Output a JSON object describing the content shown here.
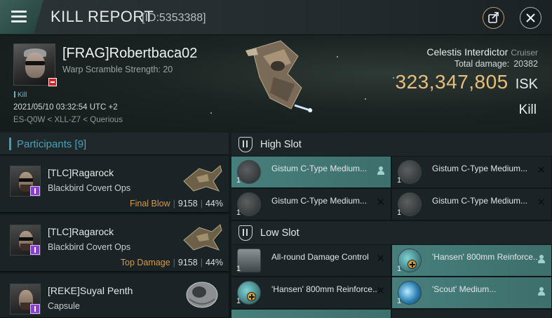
{
  "header": {
    "title": "KILL REPORT",
    "id": "[ID:5353388]"
  },
  "victim": {
    "name": "[FRAG]Robertbaca02",
    "subtitle": "Warp Scramble Strength: 20",
    "tag": "Kill",
    "timestamp": "2021/05/10 03:32:54 UTC +2",
    "location": "ES-Q0W < XLL-Z7 < Querious"
  },
  "ship": {
    "name": "Celestis Interdictor",
    "class": "Cruiser",
    "total_damage_label": "Total damage:",
    "total_damage": "20382",
    "isk_value": "323,347,805",
    "isk_unit": "ISK",
    "result": "Kill"
  },
  "participants": {
    "title": "Participants [9]",
    "items": [
      {
        "name": "[TLC]Ragarock",
        "ship": "Blackbird Covert Ops",
        "tag": "Final Blow",
        "damage": "9158",
        "percent": "44%"
      },
      {
        "name": "[TLC]Ragarock",
        "ship": "Blackbird Covert Ops",
        "tag": "Top Damage",
        "damage": "9158",
        "percent": "44%"
      },
      {
        "name": "[REKE]Suyal Penth",
        "ship": "Capsule",
        "tag": "",
        "damage": "",
        "percent": ""
      }
    ]
  },
  "slots": {
    "high": {
      "title": "High Slot",
      "modules": [
        {
          "qty": "1",
          "name": "Gistum C-Type Medium..."
        },
        {
          "qty": "1",
          "name": "Gistum C-Type Medium..."
        },
        {
          "qty": "1",
          "name": "Gistum C-Type Medium..."
        },
        {
          "qty": "1",
          "name": "Gistum C-Type Medium..."
        }
      ]
    },
    "low": {
      "title": "Low Slot",
      "modules": [
        {
          "qty": "1",
          "name": "All-round Damage Control"
        },
        {
          "qty": "1",
          "name": "'Hansen' 800mm Reinforce..."
        },
        {
          "qty": "1",
          "name": "'Hansen' 800mm Reinforce..."
        },
        {
          "qty": "1",
          "name": "'Scout' Medium..."
        }
      ]
    }
  },
  "icons": {
    "menu": "menu-icon",
    "share": "share-icon",
    "close": "close-icon",
    "slot": "slot-shield-icon",
    "destroyed": "destroyed-x-icon",
    "dropped": "dropped-user-icon"
  },
  "colors": {
    "isk": "#e9bd7c",
    "accent": "#4aa2b8",
    "highlight": "#477f7c",
    "final_blow": "#d59a4b"
  }
}
